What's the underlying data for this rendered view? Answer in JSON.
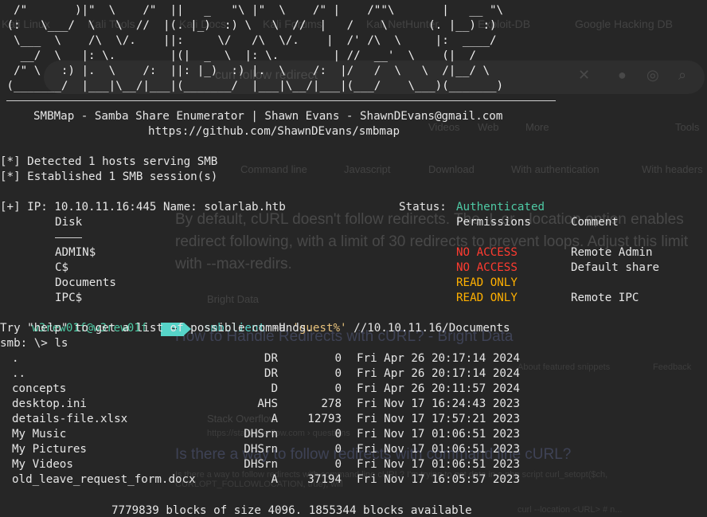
{
  "ghost": {
    "bookmarks": [
      "Kali Linux",
      "Kali Tools",
      "Kali Docs",
      "Kali Forums",
      "Kali NetHunter",
      "Exploit-DB",
      "Google Hacking DB"
    ],
    "search_query": "curl follow redirect",
    "toolbar_links": [
      "Videos",
      "Web",
      "More",
      "Tools"
    ],
    "filter_chips": [
      "Command line",
      "Javascript",
      "Download",
      "With authentication",
      "With headers"
    ],
    "snippet": "By default, cURL doesn't follow redirects. The -L or --location option enables redirect following, with a limit of 30 redirects to prevent loops. Adjust this limit with --max-redirs.",
    "result1_source": "Bright Data",
    "result1_title": "How to Handle Redirects with cURL? - Bright Data",
    "about_label": "About featured snippets",
    "feedback_label": "Feedback",
    "result2_source": "Stack Overflow",
    "result2_url": "https://stackoverflow.com › questions",
    "result2_title": "Is there a way to follow redirects with command line cURL?",
    "result2_snippet": "Is there a way to follow redirects with command line cURL? I'm trying to get data in a php script curl_setopt($ch, CURLOPT_FOLLOWLOCATION, true); will",
    "result2_snippet2": "curl --location <URL> # n..."
  },
  "terminal": {
    "banner": [
      "  /\"       )|\"  \\    /\"  ||   _   \"\\ |\"  \\    /\" |    /\"\"\\       |   __ \"\\",
      " (:   \\___/  \\   \\  //  |(. |_)  :) \\   \\  //  |   /    \\      (. |__) :)",
      "  \\___  \\    /\\  \\/.    ||:     \\/   /\\  \\/.    |  /' /\\  \\     |:  ____/",
      "   __/  \\   |: \\.        |(|  _  \\  |: \\.        | //  __'  \\    (|  /",
      "  /\" \\   :) |.  \\    /:  ||: |_)  :) |.  \\    /:  |/   /  \\   \\  /|__/ \\",
      " (_______/  |___|\\__/|___|(_______/  |___|\\__/|___|(___/    \\___)(_______)"
    ],
    "credit_line": "SMBMap - Samba Share Enumerator | Shawn Evans - ShawnDEvans@gmail.com",
    "url_line": "https://github.com/ShawnDEvans/smbmap",
    "detected": "[*] Detected 1 hosts serving SMB",
    "established": "[*] Established 1 SMB session(s)",
    "ip_line_prefix": "[+] IP: 10.10.11.16:445 Name: solarlab.htb",
    "status_label": "Status:",
    "status_value": "Authenticated",
    "col_disk": "Disk",
    "col_permissions": "Permissions",
    "col_comment": "Comment",
    "shares": [
      {
        "name": "ADMIN$",
        "perm": "NO ACCESS",
        "comment": "Remote Admin"
      },
      {
        "name": "C$",
        "perm": "NO ACCESS",
        "comment": "Default share"
      },
      {
        "name": "Documents",
        "perm": "READ ONLY",
        "comment": ""
      },
      {
        "name": "IPC$",
        "perm": "READ ONLY",
        "comment": "Remote IPC"
      }
    ],
    "prompt_user": "w3rew01f@w3rew01f",
    "prompt_dir": "~",
    "cmd_name": "smbclient",
    "cmd_flag": "-U",
    "cmd_string": "'guest%'",
    "cmd_path": "//10.10.11.16/Documents",
    "help_line": "Try \"help\" to get a list of possible commands.",
    "smb_prompt": "smb: \\> ls",
    "files": [
      {
        "name": ".",
        "attr": "DR",
        "size": "0",
        "date": "Fri Apr 26 20:17:14 2024"
      },
      {
        "name": "..",
        "attr": "DR",
        "size": "0",
        "date": "Fri Apr 26 20:17:14 2024"
      },
      {
        "name": "concepts",
        "attr": "D",
        "size": "0",
        "date": "Fri Apr 26 20:11:57 2024"
      },
      {
        "name": "desktop.ini",
        "attr": "AHS",
        "size": "278",
        "date": "Fri Nov 17 16:24:43 2023"
      },
      {
        "name": "details-file.xlsx",
        "attr": "A",
        "size": "12793",
        "date": "Fri Nov 17 17:57:21 2023"
      },
      {
        "name": "My Music",
        "attr": "DHSrn",
        "size": "0",
        "date": "Fri Nov 17 01:06:51 2023"
      },
      {
        "name": "My Pictures",
        "attr": "DHSrn",
        "size": "0",
        "date": "Fri Nov 17 01:06:51 2023"
      },
      {
        "name": "My Videos",
        "attr": "DHSrn",
        "size": "0",
        "date": "Fri Nov 17 01:06:51 2023"
      },
      {
        "name": "old_leave_request_form.docx",
        "attr": "A",
        "size": "37194",
        "date": "Fri Nov 17 16:05:57 2023"
      }
    ],
    "blocks_line": "7779839 blocks of size 4096. 1855344 blocks available"
  },
  "colors": {
    "background": "#262626",
    "authenticated": "#4ec9a4",
    "no_access": "#ff3b30",
    "read_only": "#ffb000",
    "prompt_badge": "#56d4c8"
  }
}
